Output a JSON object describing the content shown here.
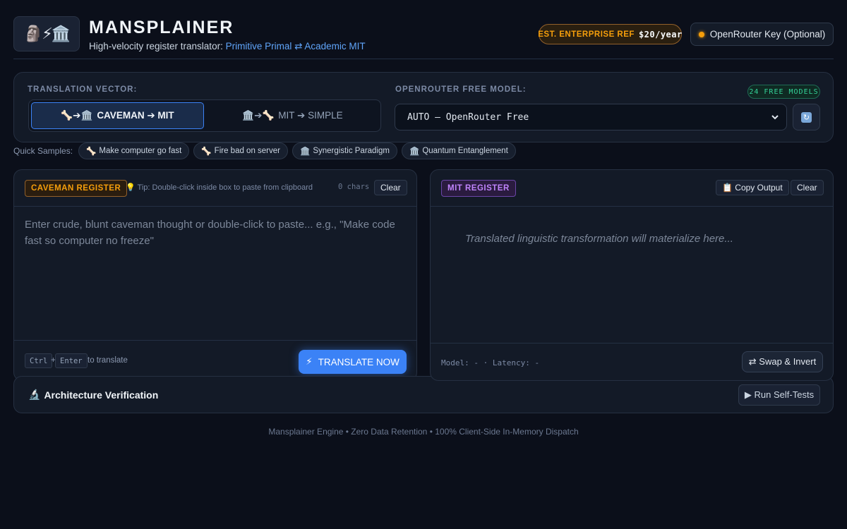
{
  "header": {
    "logo_emoji": "🗿⚡🏛️",
    "title": "MANSPLAINER",
    "subtitle_prefix": "High-velocity register translator: ",
    "subtitle_highlight": "Primitive Primal ⇄ Academic MIT",
    "enterprise_label": "EST. ENTERPRISE REF",
    "enterprise_price": "$20/year",
    "key_button": "OpenRouter Key (Optional)"
  },
  "controls": {
    "vector_label": "TRANSLATION VECTOR:",
    "vector_options": [
      {
        "icon": "🦴➔🏛️",
        "label": "CAVEMAN ➔ MIT",
        "active": true
      },
      {
        "icon": "🏛️➔🦴",
        "label": "MIT ➔ SIMPLE",
        "active": false
      }
    ],
    "model_label": "OPENROUTER FREE MODEL:",
    "models_badge": "24 FREE MODELS",
    "selected_model": "AUTO — OpenRouter Free"
  },
  "quick_samples": {
    "label": "Quick Samples:",
    "items": [
      {
        "icon": "🦴",
        "label": "Make computer go fast"
      },
      {
        "icon": "🦴",
        "label": "Fire bad on server"
      },
      {
        "icon": "🏛️",
        "label": "Synergistic Paradigm"
      },
      {
        "icon": "🏛️",
        "label": "Quantum Entanglement"
      }
    ]
  },
  "input_panel": {
    "badge": "CAVEMAN REGISTER",
    "tip": "💡 Tip: Double-click inside box to paste from clipboard",
    "char_count": "0 chars",
    "clear_label": "Clear",
    "placeholder": "Enter crude, blunt caveman thought or double-click to paste... e.g., \"Make code fast so computer no freeze\"",
    "kbd_ctrl": "Ctrl",
    "kbd_plus": "+",
    "kbd_enter": "Enter",
    "kbd_hint": "to translate",
    "translate_icon": "⚡",
    "translate_label": "TRANSLATE NOW"
  },
  "output_panel": {
    "badge": "MIT REGISTER",
    "copy_label": "📋 Copy Output",
    "clear_label": "Clear",
    "placeholder": "Translated linguistic transformation will materialize here...",
    "meta": "Model: - · Latency: -",
    "swap_label": "⇄ Swap & Invert"
  },
  "architecture": {
    "icon": "🔬",
    "title": "Architecture Verification",
    "button": "▶ Run Self-Tests"
  },
  "footer": "Mansplainer Engine • Zero Data Retention • 100% Client-Side In-Memory Dispatch",
  "colors": {
    "background": "#0b0f1a",
    "accent_blue": "#3b82f6",
    "caveman_amber": "#f59e0b",
    "mit_purple": "#c084fc",
    "free_green": "#34d399"
  }
}
